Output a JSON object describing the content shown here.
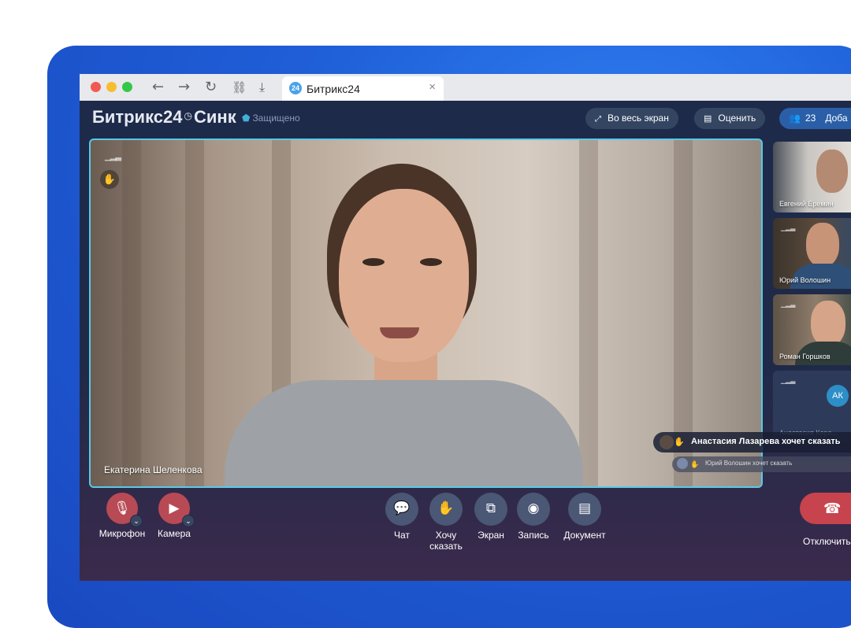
{
  "browser": {
    "tab_title": "Битрикс24",
    "tab_icon_text": "24",
    "close_glyph": "×"
  },
  "header": {
    "logo_part1": "Битрикс24",
    "logo_clock": "◷",
    "logo_part2": "Синк",
    "secure_label": "Защищено",
    "fullscreen_label": "Во весь экран",
    "rate_label": "Оценить",
    "participants_count": "23",
    "add_label": "Доба"
  },
  "main_speaker": {
    "name": "Екатерина Шеленкова"
  },
  "thumbnails": [
    {
      "name": "Евгений Еремин"
    },
    {
      "name": "Юрий Волошин"
    },
    {
      "name": "Роман Горшков"
    },
    {
      "name": "Анастасия Коро...",
      "initials": "АК"
    }
  ],
  "notifications": {
    "primary": "Анастасия Лазарева хочет сказать",
    "secondary": "Юрий Волошин хочет сказать"
  },
  "controls": {
    "mic_label": "Микрофон",
    "camera_label": "Камера",
    "chat_label": "Чат",
    "raise_hand_line1": "Хочу",
    "raise_hand_line2": "сказать",
    "screen_label": "Экран",
    "record_label": "Запись",
    "document_label": "Документ",
    "hangup_label": "Отключить"
  },
  "colors": {
    "accent": "#5ac8e6",
    "hangup": "#c7434d",
    "muted_red": "#b84a55",
    "brand_blue": "#1f5fd8"
  }
}
